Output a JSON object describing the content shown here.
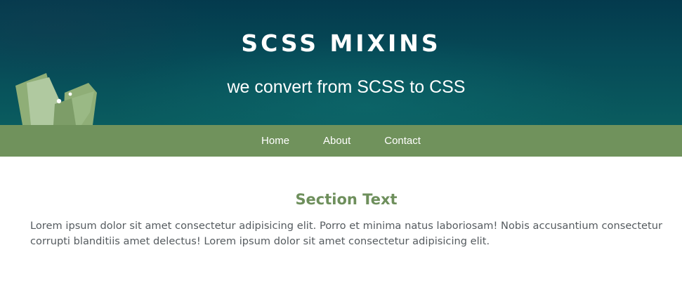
{
  "header": {
    "title": "SCSS MIXINS",
    "subtitle": "we convert from SCSS to CSS",
    "logo_icon": "leaf-logo-icon",
    "colors": {
      "hero_dark": "#043a4d",
      "hero_teal": "#0a5c5f",
      "leaf_light": "#b0c9a0",
      "leaf_mid": "#8fae77"
    }
  },
  "nav": {
    "background": "#70925c",
    "items": [
      {
        "label": "Home"
      },
      {
        "label": "About"
      },
      {
        "label": "Contact"
      }
    ]
  },
  "section": {
    "title": "Section Text",
    "body": "Lorem ipsum dolor sit amet consectetur adipisicing elit. Porro et minima natus laboriosam! Nobis accusantium consectetur corrupti blanditiis amet delectus! Lorem ipsum dolor sit amet consectetur adipisicing elit.",
    "title_color": "#6e8f5c"
  }
}
